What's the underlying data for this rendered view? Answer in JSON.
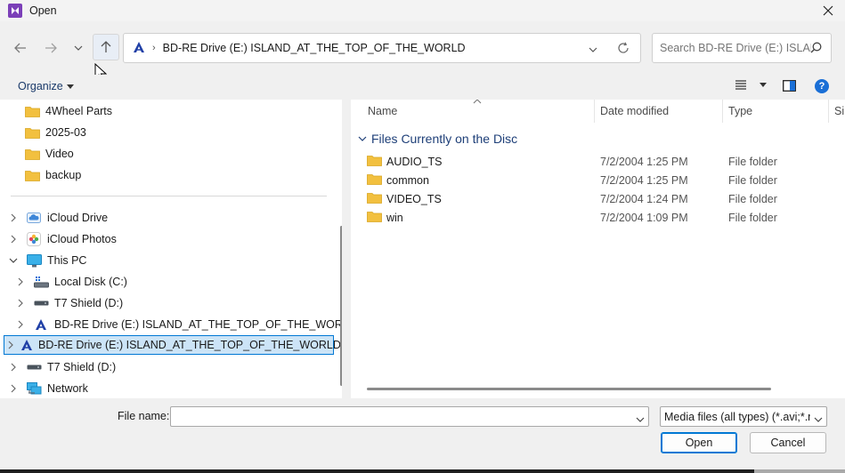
{
  "window": {
    "title": "Open",
    "accent": "#7b3fb8"
  },
  "address": {
    "path": "BD-RE Drive (E:) ISLAND_AT_THE_TOP_OF_THE_WORLD",
    "separator": "›"
  },
  "search": {
    "placeholder": "Search BD-RE Drive (E:) ISLAN..."
  },
  "toolbar": {
    "organize_label": "Organize",
    "help_label": "?"
  },
  "tree": {
    "items": [
      {
        "label": "4Wheel Parts",
        "icon": "folder-icon"
      },
      {
        "label": "2025-03",
        "icon": "folder-icon"
      },
      {
        "label": "Video",
        "icon": "folder-icon"
      },
      {
        "label": "backup",
        "icon": "folder-icon"
      },
      {
        "label": "iCloud Drive",
        "icon": "icloud-icon"
      },
      {
        "label": "iCloud Photos",
        "icon": "photos-icon"
      },
      {
        "label": "This PC",
        "icon": "monitor-icon"
      },
      {
        "label": "Local Disk (C:)",
        "icon": "local-disk-icon"
      },
      {
        "label": "T7 Shield (D:)",
        "icon": "drive-icon"
      },
      {
        "label": "BD-RE Drive (E:) ISLAND_AT_THE_TOP_OF_THE_WORLD",
        "icon": "disc-drive-icon"
      },
      {
        "label": "BD-RE Drive (E:) ISLAND_AT_THE_TOP_OF_THE_WORLD",
        "icon": "disc-drive-icon",
        "selected": true
      },
      {
        "label": "T7 Shield (D:)",
        "icon": "drive-icon"
      },
      {
        "label": "Network",
        "icon": "network-icon"
      }
    ]
  },
  "files": {
    "columns": {
      "name": "Name",
      "date": "Date modified",
      "type": "Type",
      "size": "Si"
    },
    "group_label": "Files Currently on the Disc",
    "rows": [
      {
        "name": "AUDIO_TS",
        "date": "7/2/2004 1:25 PM",
        "type": "File folder"
      },
      {
        "name": "common",
        "date": "7/2/2004 1:25 PM",
        "type": "File folder"
      },
      {
        "name": "VIDEO_TS",
        "date": "7/2/2004 1:24 PM",
        "type": "File folder"
      },
      {
        "name": "win",
        "date": "7/2/2004 1:09 PM",
        "type": "File folder"
      }
    ]
  },
  "bottom": {
    "file_name_label": "File name:",
    "file_name_value": "",
    "filter_value": "Media files (all types) (*.avi;*.m",
    "open_label": "Open",
    "cancel_label": "Cancel"
  },
  "colors": {
    "folder": "#f2c03f",
    "selected_bg": "#cce4f7",
    "selected_border": "#0078d4",
    "group_text": "#1e3f78",
    "help_bg": "#1a6fd6"
  }
}
